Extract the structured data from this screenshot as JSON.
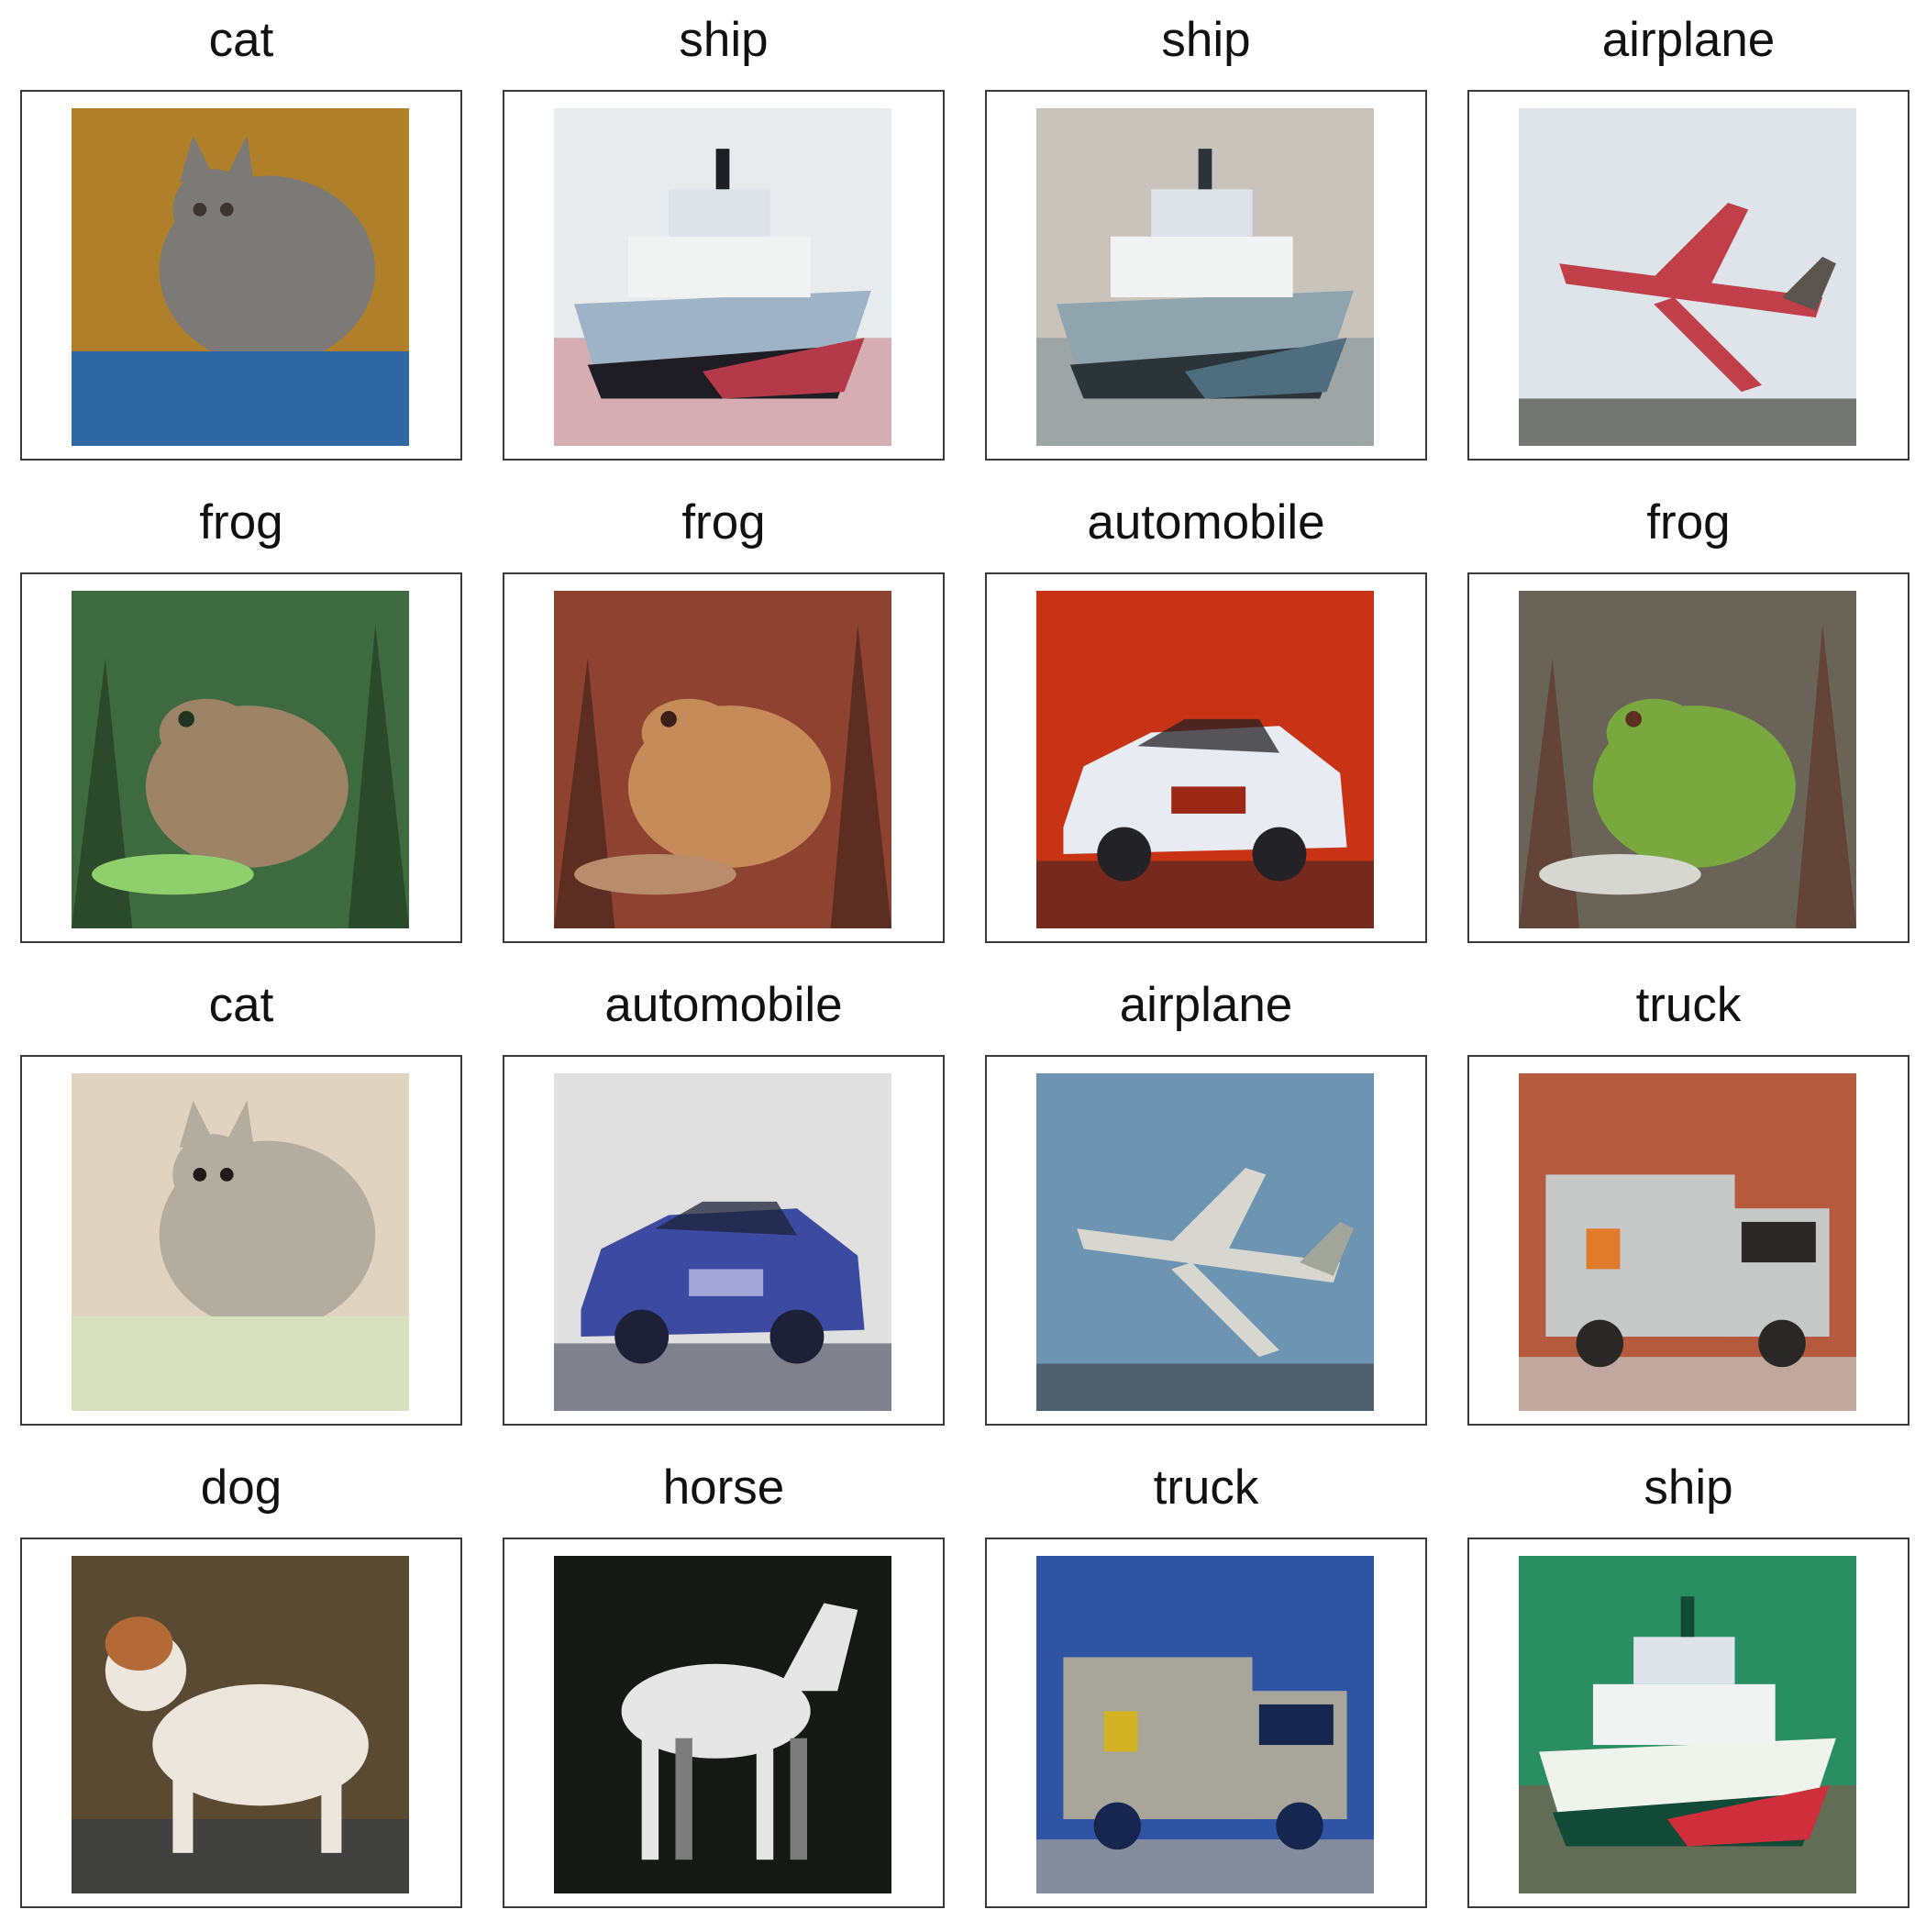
{
  "grid": {
    "cells": [
      {
        "label": "cat",
        "icon": "cat-photo",
        "palette": {
          "bg": "#b07f2a",
          "mid": "#7c7a76",
          "accent": "#2e67a3",
          "dark": "#3b3430"
        }
      },
      {
        "label": "ship",
        "icon": "ship-photo",
        "palette": {
          "bg": "#e7ebec",
          "mid": "#9fb3c6",
          "accent": "#b53a49",
          "dark": "#1e1d23"
        }
      },
      {
        "label": "ship",
        "icon": "ship-photo",
        "palette": {
          "bg": "#c8c4bb",
          "mid": "#8fa4ad",
          "accent": "#4e6d7e",
          "dark": "#2b3438"
        }
      },
      {
        "label": "airplane",
        "icon": "airplane-photo",
        "palette": {
          "bg": "#dfe4ea",
          "mid": "#c03f49",
          "accent": "#5a564f",
          "dark": "#2d2d25"
        }
      },
      {
        "label": "frog",
        "icon": "frog-photo",
        "palette": {
          "bg": "#3d6a3f",
          "mid": "#9d8467",
          "accent": "#8fcf6c",
          "dark": "#1f3520"
        }
      },
      {
        "label": "frog",
        "icon": "frog-photo",
        "palette": {
          "bg": "#8d4330",
          "mid": "#c58c59",
          "accent": "#b98d6c",
          "dark": "#3c1f17"
        }
      },
      {
        "label": "automobile",
        "icon": "car-photo",
        "palette": {
          "bg": "#c73314",
          "mid": "#e8ebf2",
          "accent": "#9b2714",
          "dark": "#232226"
        }
      },
      {
        "label": "frog",
        "icon": "frog-photo",
        "palette": {
          "bg": "#6a6358",
          "mid": "#78a83e",
          "accent": "#d6d7d0",
          "dark": "#5d3023"
        }
      },
      {
        "label": "cat",
        "icon": "cat-photo",
        "palette": {
          "bg": "#e0d3bf",
          "mid": "#b3ada0",
          "accent": "#d8e0bf",
          "dark": "#1f1c18"
        }
      },
      {
        "label": "automobile",
        "icon": "car-photo",
        "palette": {
          "bg": "#e0e0e0",
          "mid": "#3c4ba1",
          "accent": "#a4a8d8",
          "dark": "#1d2137"
        }
      },
      {
        "label": "airplane",
        "icon": "airplane-photo",
        "palette": {
          "bg": "#6d95b1",
          "mid": "#d7d7cf",
          "accent": "#a2a59a",
          "dark": "#3c3e42"
        }
      },
      {
        "label": "truck",
        "icon": "truck-photo",
        "palette": {
          "bg": "#b55a3d",
          "mid": "#c6c9c8",
          "accent": "#e07b2c",
          "dark": "#2a2826"
        }
      },
      {
        "label": "dog",
        "icon": "dog-photo",
        "palette": {
          "bg": "#5a4a32",
          "mid": "#ece6dc",
          "accent": "#b46a36",
          "dark": "#25364b"
        }
      },
      {
        "label": "horse",
        "icon": "horse-photo",
        "palette": {
          "bg": "#151815",
          "mid": "#e6e6e6",
          "accent": "#7c7c7c",
          "dark": "#050605"
        }
      },
      {
        "label": "truck",
        "icon": "truck-photo",
        "palette": {
          "bg": "#2f54a4",
          "mid": "#a8a59b",
          "accent": "#d3b324",
          "dark": "#17264f"
        }
      },
      {
        "label": "ship",
        "icon": "ship-photo",
        "palette": {
          "bg": "#2a8e63",
          "mid": "#eef3ec",
          "accent": "#cf2f3b",
          "dark": "#114a36"
        }
      }
    ]
  }
}
